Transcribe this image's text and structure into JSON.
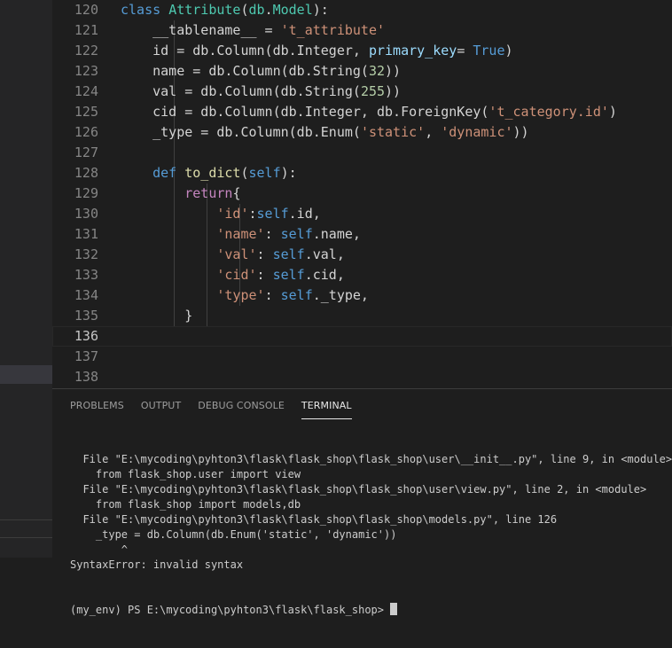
{
  "editor": {
    "lines": [
      {
        "n": "120",
        "tokens": [
          {
            "t": "class",
            "c": "kw"
          },
          {
            "t": " "
          },
          {
            "t": "Attribute",
            "c": "cls"
          },
          {
            "t": "("
          },
          {
            "t": "db",
            "c": "cls"
          },
          {
            "t": "."
          },
          {
            "t": "Model",
            "c": "cls"
          },
          {
            "t": "):"
          }
        ]
      },
      {
        "n": "121",
        "tokens": [
          {
            "t": "    __tablename__ = "
          },
          {
            "t": "'t_attribute'",
            "c": "str"
          }
        ]
      },
      {
        "n": "122",
        "tokens": [
          {
            "t": "    id = db.Column(db.Integer, "
          },
          {
            "t": "primary_key",
            "c": "var"
          },
          {
            "t": "= "
          },
          {
            "t": "True",
            "c": "kw"
          },
          {
            "t": ")"
          }
        ]
      },
      {
        "n": "123",
        "tokens": [
          {
            "t": "    name = db.Column(db.String("
          },
          {
            "t": "32",
            "c": "num"
          },
          {
            "t": "))"
          }
        ]
      },
      {
        "n": "124",
        "tokens": [
          {
            "t": "    val = db.Column(db.String("
          },
          {
            "t": "255",
            "c": "num"
          },
          {
            "t": "))"
          }
        ]
      },
      {
        "n": "125",
        "tokens": [
          {
            "t": "    cid = db.Column(db.Integer, db.ForeignKey("
          },
          {
            "t": "'t_category.id'",
            "c": "str"
          },
          {
            "t": ")"
          }
        ]
      },
      {
        "n": "126",
        "tokens": [
          {
            "t": "    _type = db.Column(db.Enum("
          },
          {
            "t": "'static'",
            "c": "str"
          },
          {
            "t": ", "
          },
          {
            "t": "'dynamic'",
            "c": "str"
          },
          {
            "t": "))"
          }
        ]
      },
      {
        "n": "127",
        "tokens": []
      },
      {
        "n": "128",
        "tokens": [
          {
            "t": "    "
          },
          {
            "t": "def",
            "c": "kw"
          },
          {
            "t": " "
          },
          {
            "t": "to_dict",
            "c": "fn"
          },
          {
            "t": "("
          },
          {
            "t": "self",
            "c": "self"
          },
          {
            "t": "):"
          }
        ]
      },
      {
        "n": "129",
        "tokens": [
          {
            "t": "        "
          },
          {
            "t": "return",
            "c": "ctl"
          },
          {
            "t": "{"
          }
        ]
      },
      {
        "n": "130",
        "tokens": [
          {
            "t": "            "
          },
          {
            "t": "'id'",
            "c": "str"
          },
          {
            "t": ":"
          },
          {
            "t": "self",
            "c": "self"
          },
          {
            "t": ".id,"
          }
        ]
      },
      {
        "n": "131",
        "tokens": [
          {
            "t": "            "
          },
          {
            "t": "'name'",
            "c": "str"
          },
          {
            "t": ": "
          },
          {
            "t": "self",
            "c": "self"
          },
          {
            "t": ".name,"
          }
        ]
      },
      {
        "n": "132",
        "tokens": [
          {
            "t": "            "
          },
          {
            "t": "'val'",
            "c": "str"
          },
          {
            "t": ": "
          },
          {
            "t": "self",
            "c": "self"
          },
          {
            "t": ".val,"
          }
        ]
      },
      {
        "n": "133",
        "tokens": [
          {
            "t": "            "
          },
          {
            "t": "'cid'",
            "c": "str"
          },
          {
            "t": ": "
          },
          {
            "t": "self",
            "c": "self"
          },
          {
            "t": ".cid,"
          }
        ]
      },
      {
        "n": "134",
        "tokens": [
          {
            "t": "            "
          },
          {
            "t": "'type'",
            "c": "str"
          },
          {
            "t": ": "
          },
          {
            "t": "self",
            "c": "self"
          },
          {
            "t": "._type,"
          }
        ]
      },
      {
        "n": "135",
        "tokens": [
          {
            "t": "        }"
          }
        ]
      },
      {
        "n": "136",
        "tokens": [],
        "current": true
      },
      {
        "n": "137",
        "tokens": []
      },
      {
        "n": "138",
        "tokens": []
      }
    ]
  },
  "panel": {
    "tabs": [
      {
        "label": "PROBLEMS"
      },
      {
        "label": "OUTPUT"
      },
      {
        "label": "DEBUG CONSOLE"
      },
      {
        "label": "TERMINAL",
        "active": true
      }
    ],
    "terminal_lines": [
      "  File \"E:\\mycoding\\pyhton3\\flask\\flask_shop\\flask_shop\\user\\__init__.py\", line 9, in <module>",
      "    from flask_shop.user import view",
      "  File \"E:\\mycoding\\pyhton3\\flask\\flask_shop\\flask_shop\\user\\view.py\", line 2, in <module>",
      "    from flask_shop import models,db",
      "  File \"E:\\mycoding\\pyhton3\\flask\\flask_shop\\flask_shop\\models.py\", line 126",
      "    _type = db.Column(db.Enum('static', 'dynamic'))",
      "        ^",
      "SyntaxError: invalid syntax"
    ],
    "prompt": "(my_env) PS E:\\mycoding\\pyhton3\\flask\\flask_shop> "
  },
  "colors": {
    "background": "#1e1e1e",
    "sidebar": "#252526",
    "keyword": "#569cd6",
    "string": "#ce9178",
    "class": "#4ec9b0",
    "function": "#dcdcaa",
    "control": "#c586c0",
    "number": "#b5cea8"
  }
}
